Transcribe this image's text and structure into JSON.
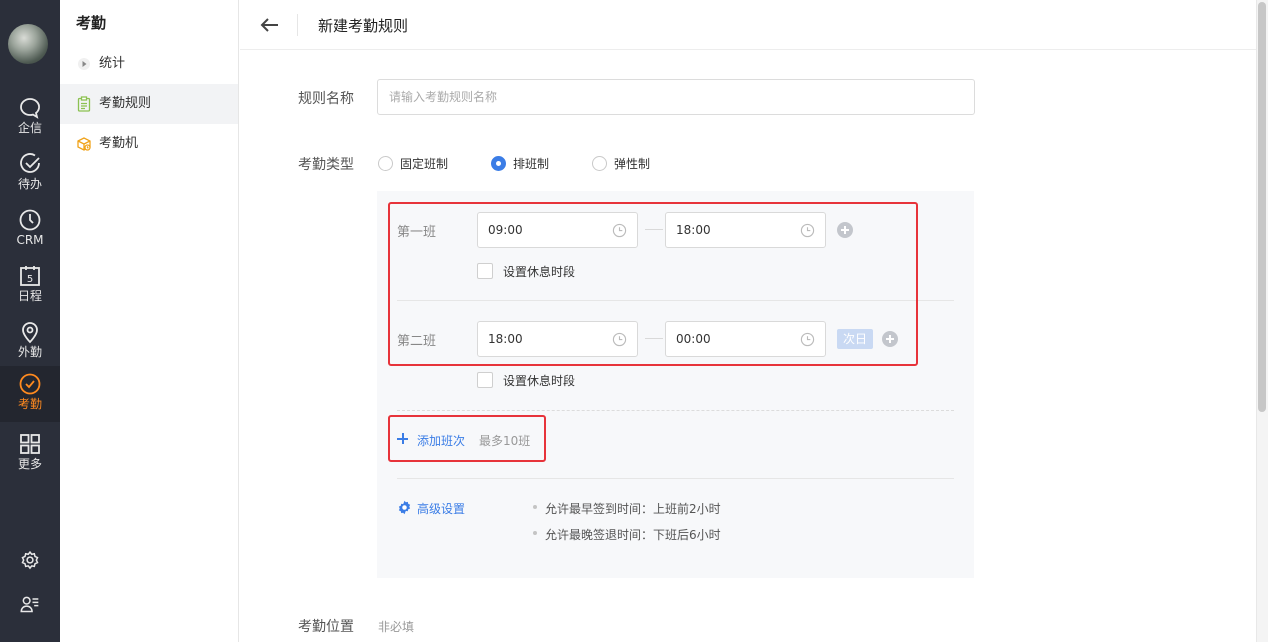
{
  "rail": {
    "items": [
      {
        "label": "企信",
        "icon": "chat-bubble-icon"
      },
      {
        "label": "待办",
        "icon": "check-circle-icon"
      },
      {
        "label": "CRM",
        "icon": "clock-icon"
      },
      {
        "label": "日程",
        "icon": "calendar-icon"
      },
      {
        "label": "外勤",
        "icon": "location-pin-icon"
      },
      {
        "label": "考勤",
        "icon": "attendance-check-icon",
        "active": true
      },
      {
        "label": "更多",
        "icon": "grid-icon"
      }
    ],
    "calendar_day": "5",
    "active_color": "#ff8a1f"
  },
  "sidebar": {
    "title": "考勤",
    "items": [
      {
        "label": "统计",
        "icon": "caret-right-icon"
      },
      {
        "label": "考勤规则",
        "icon": "clipboard-icon",
        "active": true
      },
      {
        "label": "考勤机",
        "icon": "attendance-machine-icon"
      }
    ]
  },
  "header": {
    "title": "新建考勤规则"
  },
  "form": {
    "rule_name": {
      "label": "规则名称",
      "placeholder": "请输入考勤规则名称",
      "value": ""
    },
    "type": {
      "label": "考勤类型",
      "options": [
        "固定班制",
        "排班制",
        "弹性制"
      ],
      "selected": "排班制"
    },
    "shifts": [
      {
        "label": "第一班",
        "start": "09:00",
        "end": "18:00",
        "rest_label": "设置休息时段"
      },
      {
        "label": "第二班",
        "start": "18:00",
        "end": "00:00",
        "next_day": "次日",
        "rest_label": "设置休息时段"
      }
    ],
    "add_shift": {
      "label": "添加班次",
      "hint": "最多10班"
    },
    "advanced": {
      "label": "高级设置",
      "rules": [
        "允许最早签到时间：上班前2小时",
        "允许最晚签退时间：下班后6小时"
      ]
    },
    "location": {
      "label": "考勤位置",
      "hint": "非必填"
    }
  },
  "colors": {
    "accent": "#3b7de6",
    "highlight": "#e7333a",
    "rail_bg": "#2b2f3a"
  }
}
